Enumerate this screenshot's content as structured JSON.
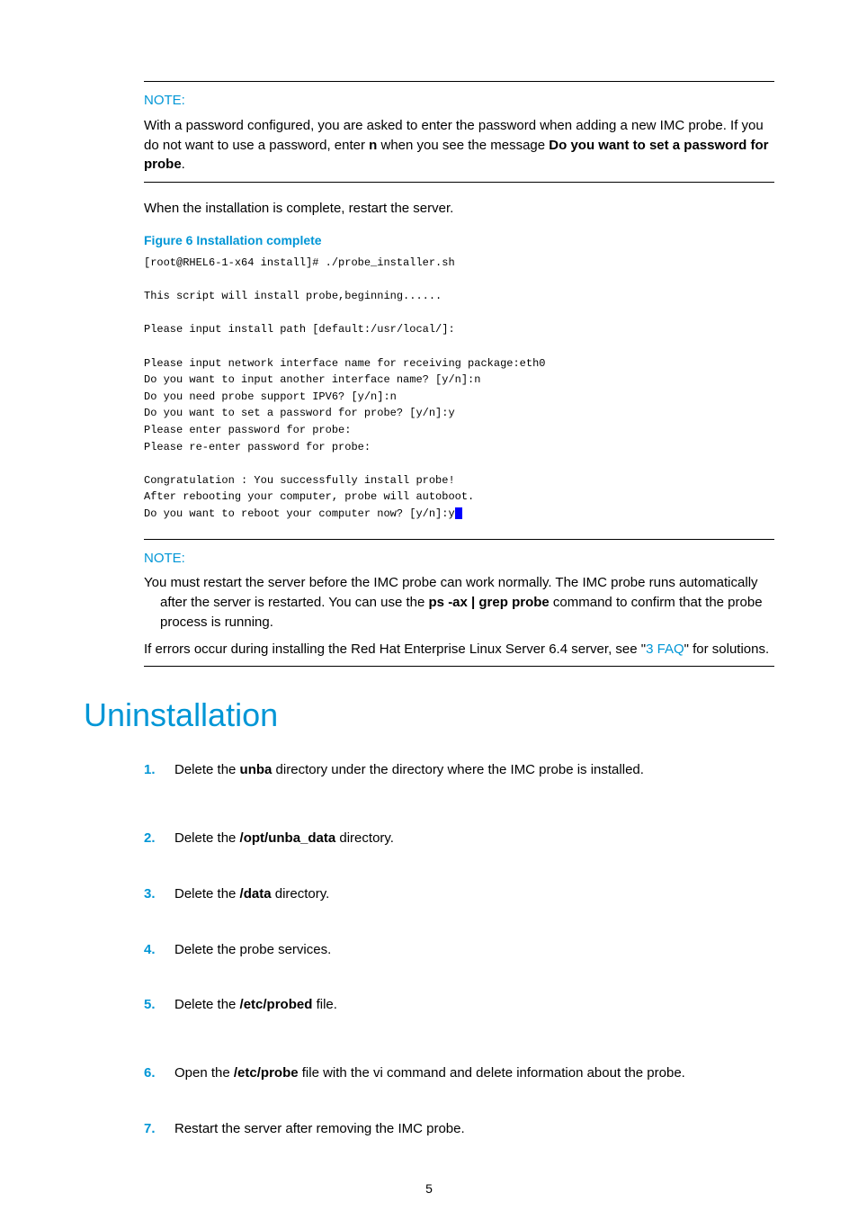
{
  "note1": {
    "label": "NOTE:",
    "text_pre": "With a password configured, you are asked to enter the password when adding a new IMC probe. If you do not want to use a password, enter ",
    "bold1": "n",
    "text_mid": " when you see the message ",
    "bold2": "Do you want to set a password for probe",
    "text_end": "."
  },
  "body1": "When the installation is complete, restart the server.",
  "figure": {
    "caption": "Figure 6 Installation complete",
    "terminal": "[root@RHEL6-1-x64 install]# ./probe_installer.sh\n\nThis script will install probe,beginning......\n\nPlease input install path [default:/usr/local/]:\n\nPlease input network interface name for receiving package:eth0\nDo you want to input another interface name? [y/n]:n\nDo you need probe support IPV6? [y/n]:n\nDo you want to set a password for probe? [y/n]:y\nPlease enter password for probe:\nPlease re-enter password for probe:\n\nCongratulation : You successfully install probe!\nAfter rebooting your computer, probe will autoboot.\nDo you want to reboot your computer now? [y/n]:y"
  },
  "note2": {
    "label": "NOTE:",
    "p1_pre": "You must restart the server before the IMC probe can work normally. The IMC probe runs automatically after the server is restarted. You can use the ",
    "p1_bold": "ps -ax | grep probe",
    "p1_post": " command to confirm that the probe process is running.",
    "p2_pre": "If errors occur during installing the Red Hat Enterprise Linux Server 6.4 server, see \"",
    "p2_link": "3 FAQ",
    "p2_post": "\" for solutions."
  },
  "heading": "Uninstallation",
  "steps": [
    {
      "num": "1.",
      "pre": "Delete the ",
      "b": "unba",
      "post": " directory under the directory where the IMC probe is installed."
    },
    {
      "num": "2.",
      "pre": "Delete the ",
      "b": "/opt/unba_data",
      "post": " directory."
    },
    {
      "num": "3.",
      "pre": "Delete the ",
      "b": "/data",
      "post": " directory."
    },
    {
      "num": "4.",
      "pre": "Delete the probe services.",
      "b": "",
      "post": ""
    },
    {
      "num": "5.",
      "pre": "Delete the ",
      "b": "/etc/probed",
      "post": " file."
    },
    {
      "num": "6.",
      "pre": "Open the ",
      "b": "/etc/probe",
      "post": " file with the vi command and delete information about the probe."
    },
    {
      "num": "7.",
      "pre": "Restart the server after removing the IMC probe.",
      "b": "",
      "post": ""
    }
  ],
  "page_number": "5"
}
